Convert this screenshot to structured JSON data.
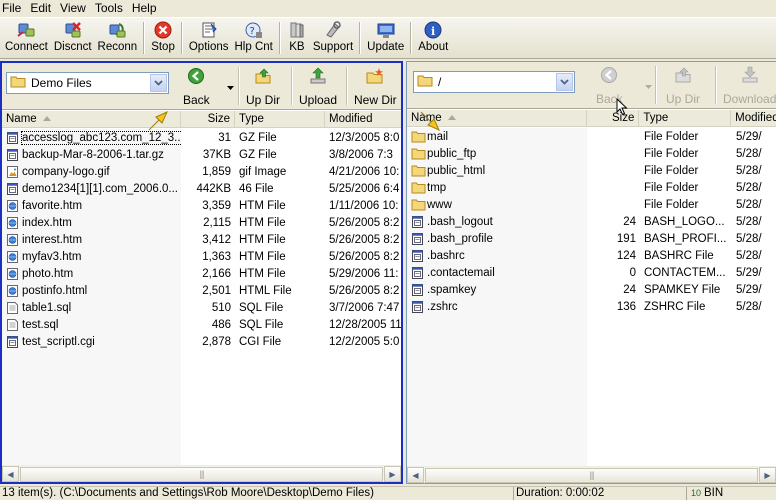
{
  "menu": [
    "File",
    "Edit",
    "View",
    "Tools",
    "Help"
  ],
  "toolbar": [
    {
      "label": "Connect",
      "icon": "connect-icon"
    },
    {
      "label": "Discnct",
      "icon": "disconnect-icon"
    },
    {
      "label": "Reconn",
      "icon": "reconnect-icon"
    },
    {
      "label": "Stop",
      "icon": "stop-icon"
    },
    {
      "label": "Options",
      "icon": "options-icon"
    },
    {
      "label": "Hlp Cnt",
      "icon": "help-center-icon"
    },
    {
      "label": "KB",
      "icon": "knowledge-base-icon"
    },
    {
      "label": "Support",
      "icon": "support-icon"
    },
    {
      "label": "Update",
      "icon": "update-icon"
    },
    {
      "label": "About",
      "icon": "about-icon"
    }
  ],
  "left": {
    "path": "Demo Files",
    "buttons": [
      "Back",
      "Up Dir",
      "Upload",
      "New Dir"
    ],
    "columns": [
      "Name",
      "Size",
      "Type",
      "Modified"
    ],
    "files": [
      {
        "name": "accesslog_abc123.com_12_3...",
        "size": "31",
        "type": "GZ File",
        "modified": "12/3/2005 8:0",
        "icon": "archive"
      },
      {
        "name": "backup-Mar-8-2006-1.tar.gz",
        "size": "37KB",
        "type": "GZ File",
        "modified": "3/8/2006 7:3",
        "icon": "archive"
      },
      {
        "name": "company-logo.gif",
        "size": "1,859",
        "type": "gif Image",
        "modified": "4/21/2006 10:",
        "icon": "image"
      },
      {
        "name": "demo1234[1][1].com_2006.0...",
        "size": "442KB",
        "type": "46 File",
        "modified": "5/25/2006 6:4",
        "icon": "archive"
      },
      {
        "name": "favorite.htm",
        "size": "3,359",
        "type": "HTM File",
        "modified": "1/11/2006 10:",
        "icon": "html"
      },
      {
        "name": "index.htm",
        "size": "2,115",
        "type": "HTM File",
        "modified": "5/26/2005 8:2",
        "icon": "html"
      },
      {
        "name": "interest.htm",
        "size": "3,412",
        "type": "HTM File",
        "modified": "5/26/2005 8:2",
        "icon": "html"
      },
      {
        "name": "myfav3.htm",
        "size": "1,363",
        "type": "HTM File",
        "modified": "5/26/2005 8:2",
        "icon": "html"
      },
      {
        "name": "photo.htm",
        "size": "2,166",
        "type": "HTM File",
        "modified": "5/29/2006 11:",
        "icon": "html"
      },
      {
        "name": "postinfo.html",
        "size": "2,501",
        "type": "HTML File",
        "modified": "5/26/2005 8:2",
        "icon": "html"
      },
      {
        "name": "table1.sql",
        "size": "510",
        "type": "SQL File",
        "modified": "3/7/2006 7:47",
        "icon": "text"
      },
      {
        "name": "test.sql",
        "size": "486",
        "type": "SQL File",
        "modified": "12/28/2005 11",
        "icon": "text"
      },
      {
        "name": "test_scriptl.cgi",
        "size": "2,878",
        "type": "CGI File",
        "modified": "12/2/2005 5:0",
        "icon": "archive"
      }
    ]
  },
  "right": {
    "path": "/",
    "buttons": [
      "Back",
      "Up Dir",
      "Download"
    ],
    "columns": [
      "Name",
      "Size",
      "Type",
      "Modified"
    ],
    "files": [
      {
        "name": "mail",
        "size": "",
        "type": "File Folder",
        "modified": "5/29/",
        "icon": "folder"
      },
      {
        "name": "public_ftp",
        "size": "",
        "type": "File Folder",
        "modified": "5/28/",
        "icon": "folder"
      },
      {
        "name": "public_html",
        "size": "",
        "type": "File Folder",
        "modified": "5/28/",
        "icon": "folder"
      },
      {
        "name": "tmp",
        "size": "",
        "type": "File Folder",
        "modified": "5/28/",
        "icon": "folder"
      },
      {
        "name": "www",
        "size": "",
        "type": "File Folder",
        "modified": "5/28/",
        "icon": "folder"
      },
      {
        "name": ".bash_logout",
        "size": "24",
        "type": "BASH_LOGO...",
        "modified": "5/28/",
        "icon": "archive"
      },
      {
        "name": ".bash_profile",
        "size": "191",
        "type": "BASH_PROFI...",
        "modified": "5/28/",
        "icon": "archive"
      },
      {
        "name": ".bashrc",
        "size": "124",
        "type": "BASHRC File",
        "modified": "5/28/",
        "icon": "archive"
      },
      {
        "name": ".contactemail",
        "size": "0",
        "type": "CONTACTEM...",
        "modified": "5/29/",
        "icon": "archive"
      },
      {
        "name": ".spamkey",
        "size": "24",
        "type": "SPAMKEY File",
        "modified": "5/29/",
        "icon": "archive"
      },
      {
        "name": ".zshrc",
        "size": "136",
        "type": "ZSHRC File",
        "modified": "5/28/",
        "icon": "archive"
      }
    ]
  },
  "status": {
    "items": "13 item(s).  (C:\\Documents and Settings\\Rob Moore\\Desktop\\Demo Files)",
    "duration": "Duration: 0:00:02",
    "mode": "BIN"
  }
}
